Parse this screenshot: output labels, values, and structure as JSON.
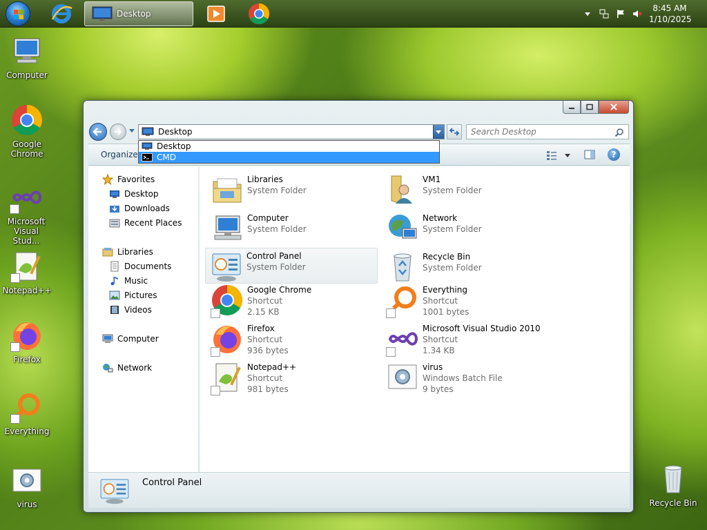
{
  "taskbar": {
    "start_icon": "windows-logo-icon",
    "pinned": [
      {
        "name": "internet-explorer",
        "icon": "ie-icon"
      },
      {
        "name": "windows-explorer",
        "label": "Desktop",
        "icon": "monitor-icon"
      },
      {
        "name": "media-player",
        "icon": "media-player-icon"
      },
      {
        "name": "google-chrome",
        "icon": "chrome-icon"
      }
    ],
    "tray_icons": [
      "chevron-up-icon",
      "network-icon",
      "flag-icon",
      "volume-muted-icon"
    ],
    "clock": {
      "time": "8:45 AM",
      "date": "1/10/2025"
    }
  },
  "desktop": {
    "icons": [
      {
        "label": "Computer",
        "icon": "computer-icon",
        "shortcut": false
      },
      {
        "label": "Google Chrome",
        "icon": "chrome-icon",
        "shortcut": false
      },
      {
        "label": "Microsoft Visual Stud...",
        "icon": "visual-studio-icon",
        "shortcut": true
      },
      {
        "label": "Notepad++",
        "icon": "notepadpp-icon",
        "shortcut": true
      },
      {
        "label": "Firefox",
        "icon": "firefox-icon",
        "shortcut": true
      },
      {
        "label": "Everything",
        "icon": "everything-icon",
        "shortcut": true
      },
      {
        "label": "virus",
        "icon": "batch-file-icon",
        "shortcut": false
      },
      {
        "label": "Recycle Bin",
        "icon": "recycle-bin-icon",
        "shortcut": false
      }
    ]
  },
  "window": {
    "address": {
      "value": "Desktop"
    },
    "address_dropdown": [
      {
        "label": "Desktop",
        "icon": "monitor-icon",
        "selected": false
      },
      {
        "label": "CMD",
        "icon": "cmd-icon",
        "selected": true
      }
    ],
    "search": {
      "placeholder": "Search Desktop"
    },
    "toolbar": {
      "organize_label": "Organize"
    },
    "nav": {
      "favorites_label": "Favorites",
      "favorites": [
        "Desktop",
        "Downloads",
        "Recent Places"
      ],
      "libraries_label": "Libraries",
      "libraries": [
        "Documents",
        "Music",
        "Pictures",
        "Videos"
      ],
      "computer_label": "Computer",
      "network_label": "Network"
    },
    "items": [
      {
        "name": "Libraries",
        "line2": "System Folder",
        "line3": "",
        "icon": "libraries-folder-icon",
        "shortcut": false,
        "highlight": false
      },
      {
        "name": "VM1",
        "line2": "System Folder",
        "line3": "",
        "icon": "user-folder-icon",
        "shortcut": false,
        "highlight": false
      },
      {
        "name": "Computer",
        "line2": "System Folder",
        "line3": "",
        "icon": "computer-icon",
        "shortcut": false,
        "highlight": false
      },
      {
        "name": "Network",
        "line2": "System Folder",
        "line3": "",
        "icon": "network-globe-icon",
        "shortcut": false,
        "highlight": false
      },
      {
        "name": "Control Panel",
        "line2": "System Folder",
        "line3": "",
        "icon": "control-panel-icon",
        "shortcut": false,
        "highlight": true
      },
      {
        "name": "Recycle Bin",
        "line2": "System Folder",
        "line3": "",
        "icon": "recycle-bin-icon",
        "shortcut": false,
        "highlight": false
      },
      {
        "name": "Google Chrome",
        "line2": "Shortcut",
        "line3": "2.15 KB",
        "icon": "chrome-icon",
        "shortcut": true,
        "highlight": false
      },
      {
        "name": "Everything",
        "line2": "Shortcut",
        "line3": "1001 bytes",
        "icon": "everything-icon",
        "shortcut": true,
        "highlight": false
      },
      {
        "name": "Firefox",
        "line2": "Shortcut",
        "line3": "936 bytes",
        "icon": "firefox-icon",
        "shortcut": true,
        "highlight": false
      },
      {
        "name": "Microsoft Visual Studio 2010",
        "line2": "Shortcut",
        "line3": "1.34 KB",
        "icon": "visual-studio-icon",
        "shortcut": true,
        "highlight": false
      },
      {
        "name": "Notepad++",
        "line2": "Shortcut",
        "line3": "981 bytes",
        "icon": "notepadpp-icon",
        "shortcut": true,
        "highlight": false
      },
      {
        "name": "virus",
        "line2": "Windows Batch File",
        "line3": "9 bytes",
        "icon": "batch-file-icon",
        "shortcut": false,
        "highlight": false
      }
    ],
    "details": {
      "name": "Control Panel",
      "icon": "control-panel-icon"
    }
  },
  "colors": {
    "selection_blue": "#3399ff",
    "taskbar": "#3a5520",
    "window_frame": "#d0dde1"
  }
}
